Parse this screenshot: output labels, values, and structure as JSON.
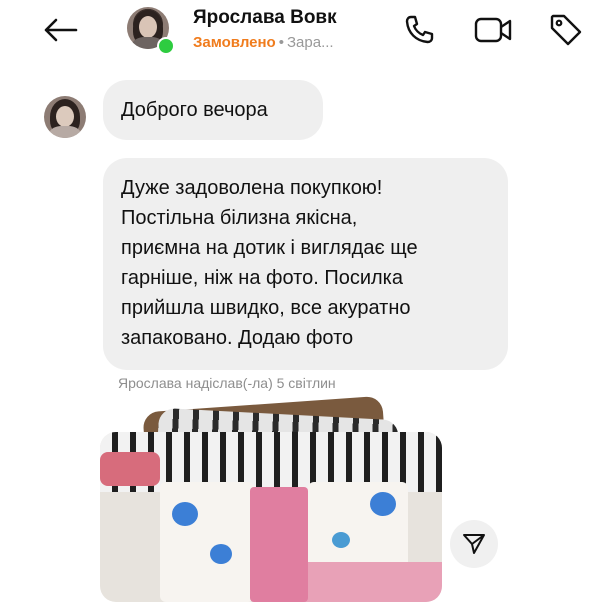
{
  "header": {
    "contact_name": "Ярослава Вовк",
    "status_ordered": "Замовлено",
    "status_separator": "•",
    "status_extra": "Зара...",
    "icons": {
      "back": "arrow-left-icon",
      "call": "phone-icon",
      "video": "video-camera-icon",
      "tag": "tag-icon"
    }
  },
  "messages": [
    {
      "text": "Доброго вечора"
    },
    {
      "text": "Дуже задоволена покупкою!\nПостільна білизна якісна,\nприємна на дотик і виглядає ще\nгарніше, ніж на фото. Посилка\nприйшла швидко, все акуратно\nзапаковано. Додаю фото"
    }
  ],
  "photos": {
    "caption": "Ярослава надіслав(-ла) 5 світлин"
  },
  "colors": {
    "status_accent": "#f07c1d",
    "online": "#2ecc40",
    "bubble_bg": "#efefef",
    "caption": "#8e8e8e"
  }
}
